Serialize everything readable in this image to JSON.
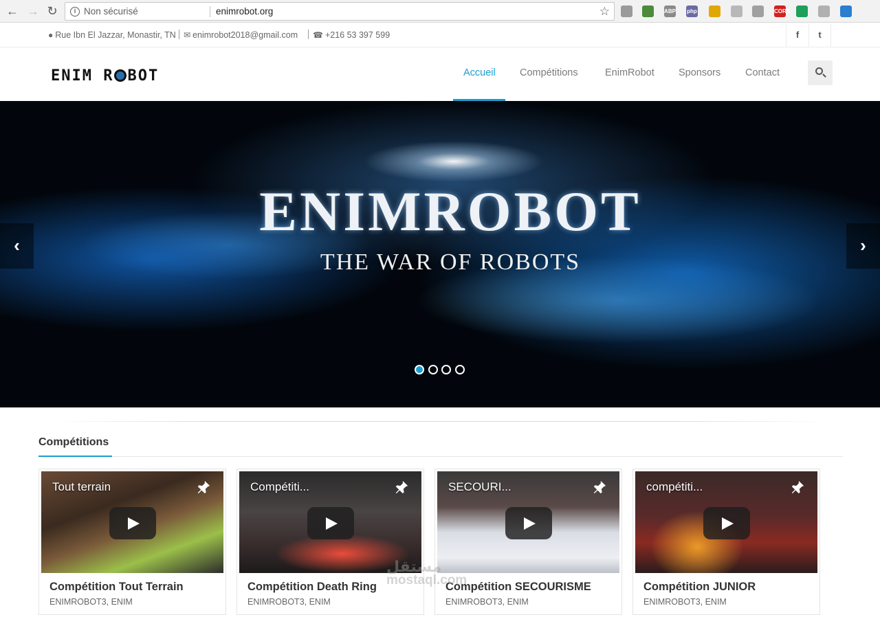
{
  "browser": {
    "security_label": "Non sécurisé",
    "url": "enimrobot.org",
    "extensions": [
      {
        "name": "pdf-extension-icon",
        "color": "#9a9a9a",
        "label": ""
      },
      {
        "name": "globe-extension-icon",
        "color": "#4c8b3a",
        "label": ""
      },
      {
        "name": "adblock-extension-icon",
        "color": "#8a8a8a",
        "label": "ABP"
      },
      {
        "name": "php-extension-icon",
        "color": "#6a6aa8",
        "label": "php"
      },
      {
        "name": "moon-extension-icon",
        "color": "#e0a800",
        "label": ""
      },
      {
        "name": "react-extension-icon",
        "color": "#b8b8b8",
        "label": ""
      },
      {
        "name": "pin-extension-icon",
        "color": "#a0a0a0",
        "label": ""
      },
      {
        "name": "cors-extension-icon",
        "color": "#d32020",
        "label": "CORS"
      },
      {
        "name": "leaf-extension-icon",
        "color": "#1ea05a",
        "label": ""
      },
      {
        "name": "page-extension-icon",
        "color": "#b0b0b0",
        "label": ""
      },
      {
        "name": "network-extension-icon",
        "color": "#2a7fd0",
        "label": ""
      }
    ]
  },
  "topbar": {
    "address": "Rue Ibn El Jazzar, Monastir, TN",
    "email": "enimrobot2018@gmail.com",
    "phone": "+216 53 397 599",
    "social": [
      {
        "name": "facebook-icon",
        "glyph": "f"
      },
      {
        "name": "twitter-icon",
        "glyph": "t"
      }
    ]
  },
  "header": {
    "logo_left": "ENIM R",
    "logo_right": "BOT",
    "menu": [
      "Accueil",
      "Compétitions",
      "EnimRobot",
      "Sponsors",
      "Contact"
    ],
    "active_index": 0
  },
  "hero": {
    "title": "ENIMROBOT",
    "subtitle": "THE WAR OF ROBOTS",
    "slides": 4,
    "active_slide": 0
  },
  "competitions": {
    "heading": "Compétitions",
    "cards": [
      {
        "video_title": "Tout terrain",
        "title": "Compétition Tout Terrain",
        "meta": "ENIMROBOT3, ENIM"
      },
      {
        "video_title": "Compétiti...",
        "title": "Compétition Death Ring",
        "meta": "ENIMROBOT3, ENIM"
      },
      {
        "video_title": "SECOURI...",
        "title": "Compétition SECOURISME",
        "meta": "ENIMROBOT3, ENIM"
      },
      {
        "video_title": "compétiti...",
        "title": "Compétition JUNIOR",
        "meta": "ENIMROBOT3, ENIM"
      }
    ]
  },
  "watermark": {
    "line1": "مستقل",
    "line2": "mostaql.com"
  },
  "colors": {
    "accent": "#1a9ed1"
  }
}
